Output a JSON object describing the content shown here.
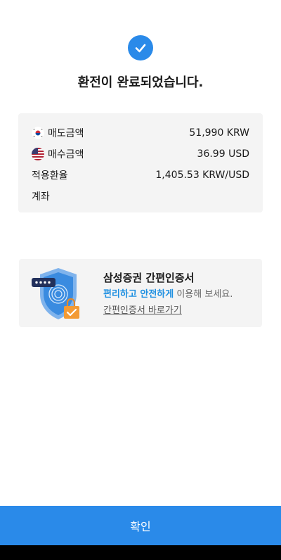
{
  "status": {
    "icon": "check-icon",
    "title": "환전이 완료되었습니다."
  },
  "summary": {
    "rows": [
      {
        "label": "매도금액",
        "flag": "korea-flag-icon",
        "value": "51,990 KRW"
      },
      {
        "label": "매수금액",
        "flag": "us-flag-icon",
        "value": "36.99 USD"
      },
      {
        "label": "적용환율",
        "value": "1,405.53 KRW/USD"
      },
      {
        "label": "계좌",
        "value": ""
      }
    ]
  },
  "promo": {
    "title": "삼성증권 간편인증서",
    "desc_highlight": "편리하고 안전하게",
    "desc_rest": " 이용해 보세요.",
    "link": "간편인증서 바로가기"
  },
  "footer": {
    "confirm_label": "확인"
  },
  "colors": {
    "accent": "#2a8ae9",
    "highlight": "#1d8fe1",
    "card_bg": "#f4f4f4"
  }
}
